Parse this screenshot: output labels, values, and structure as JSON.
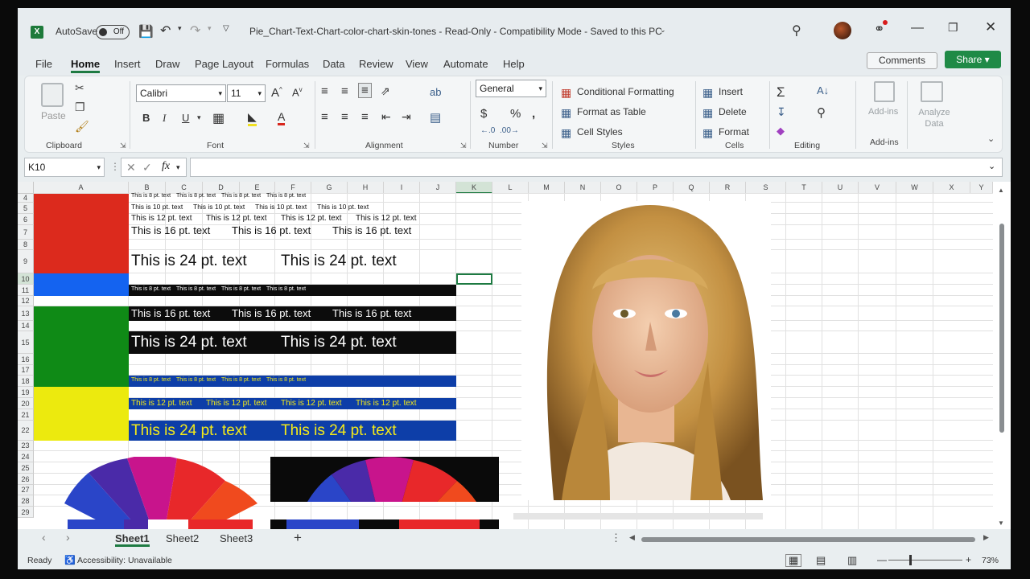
{
  "titlebar": {
    "autosave_label": "AutoSave",
    "autosave_state": "Off",
    "document_title": "Pie_Chart-Text-Chart-color-chart-skin-tones  -  Read-Only  -  Compatibility Mode  -  Saved to this PC"
  },
  "menu": {
    "items": [
      "File",
      "Home",
      "Insert",
      "Draw",
      "Page Layout",
      "Formulas",
      "Data",
      "Review",
      "View",
      "Automate",
      "Help"
    ],
    "active": "Home",
    "comments_label": "Comments",
    "share_label": "Share"
  },
  "ribbon": {
    "clipboard": {
      "label": "Clipboard",
      "paste_label": "Paste"
    },
    "font": {
      "label": "Font",
      "font_name": "Calibri",
      "font_size": "11"
    },
    "alignment": {
      "label": "Alignment"
    },
    "number": {
      "label": "Number",
      "format": "General"
    },
    "styles": {
      "label": "Styles",
      "conditional_formatting": "Conditional Formatting",
      "format_as_table": "Format as Table",
      "cell_styles": "Cell Styles"
    },
    "cells": {
      "label": "Cells",
      "insert": "Insert",
      "delete": "Delete",
      "format": "Format"
    },
    "editing": {
      "label": "Editing"
    },
    "addins": {
      "label": "Add-ins",
      "addins_button": "Add-ins",
      "analyze": "Analyze Data"
    }
  },
  "formula_bar": {
    "name_box": "K10",
    "fx_label": "fx",
    "formula": ""
  },
  "grid": {
    "columns": [
      "A",
      "B",
      "C",
      "D",
      "E",
      "F",
      "G",
      "H",
      "I",
      "J",
      "K",
      "L",
      "M",
      "N",
      "O",
      "P",
      "Q",
      "R",
      "S",
      "T",
      "U",
      "V",
      "W",
      "X",
      "Y"
    ],
    "rows": [
      "4",
      "5",
      "6",
      "7",
      "8",
      "9",
      "10",
      "11",
      "12",
      "13",
      "14",
      "15",
      "16",
      "17",
      "18",
      "19",
      "20",
      "21",
      "22",
      "23",
      "24",
      "25",
      "26",
      "27",
      "28",
      "29"
    ],
    "text_8pt": "This is 8 pt. text",
    "text_10pt": "This is 10 pt. text",
    "text_12pt": "This is 12 pt. text",
    "text_16pt": "This is 16 pt. text",
    "text_24pt": "This is 24 pt. text",
    "colors": {
      "red": "#dc2a1d",
      "blue": "#1463f0",
      "green": "#0f8a16",
      "yellow": "#ecea0e",
      "black_band": "#0c0c0c",
      "navy_band": "#0d3ea8",
      "yellow_text": "#f4ea18",
      "selection": "#1e7a42"
    }
  },
  "sheets": {
    "tabs": [
      "Sheet1",
      "Sheet2",
      "Sheet3"
    ],
    "active": "Sheet1"
  },
  "status": {
    "ready": "Ready",
    "accessibility": "Accessibility: Unavailable",
    "zoom": "73%"
  }
}
